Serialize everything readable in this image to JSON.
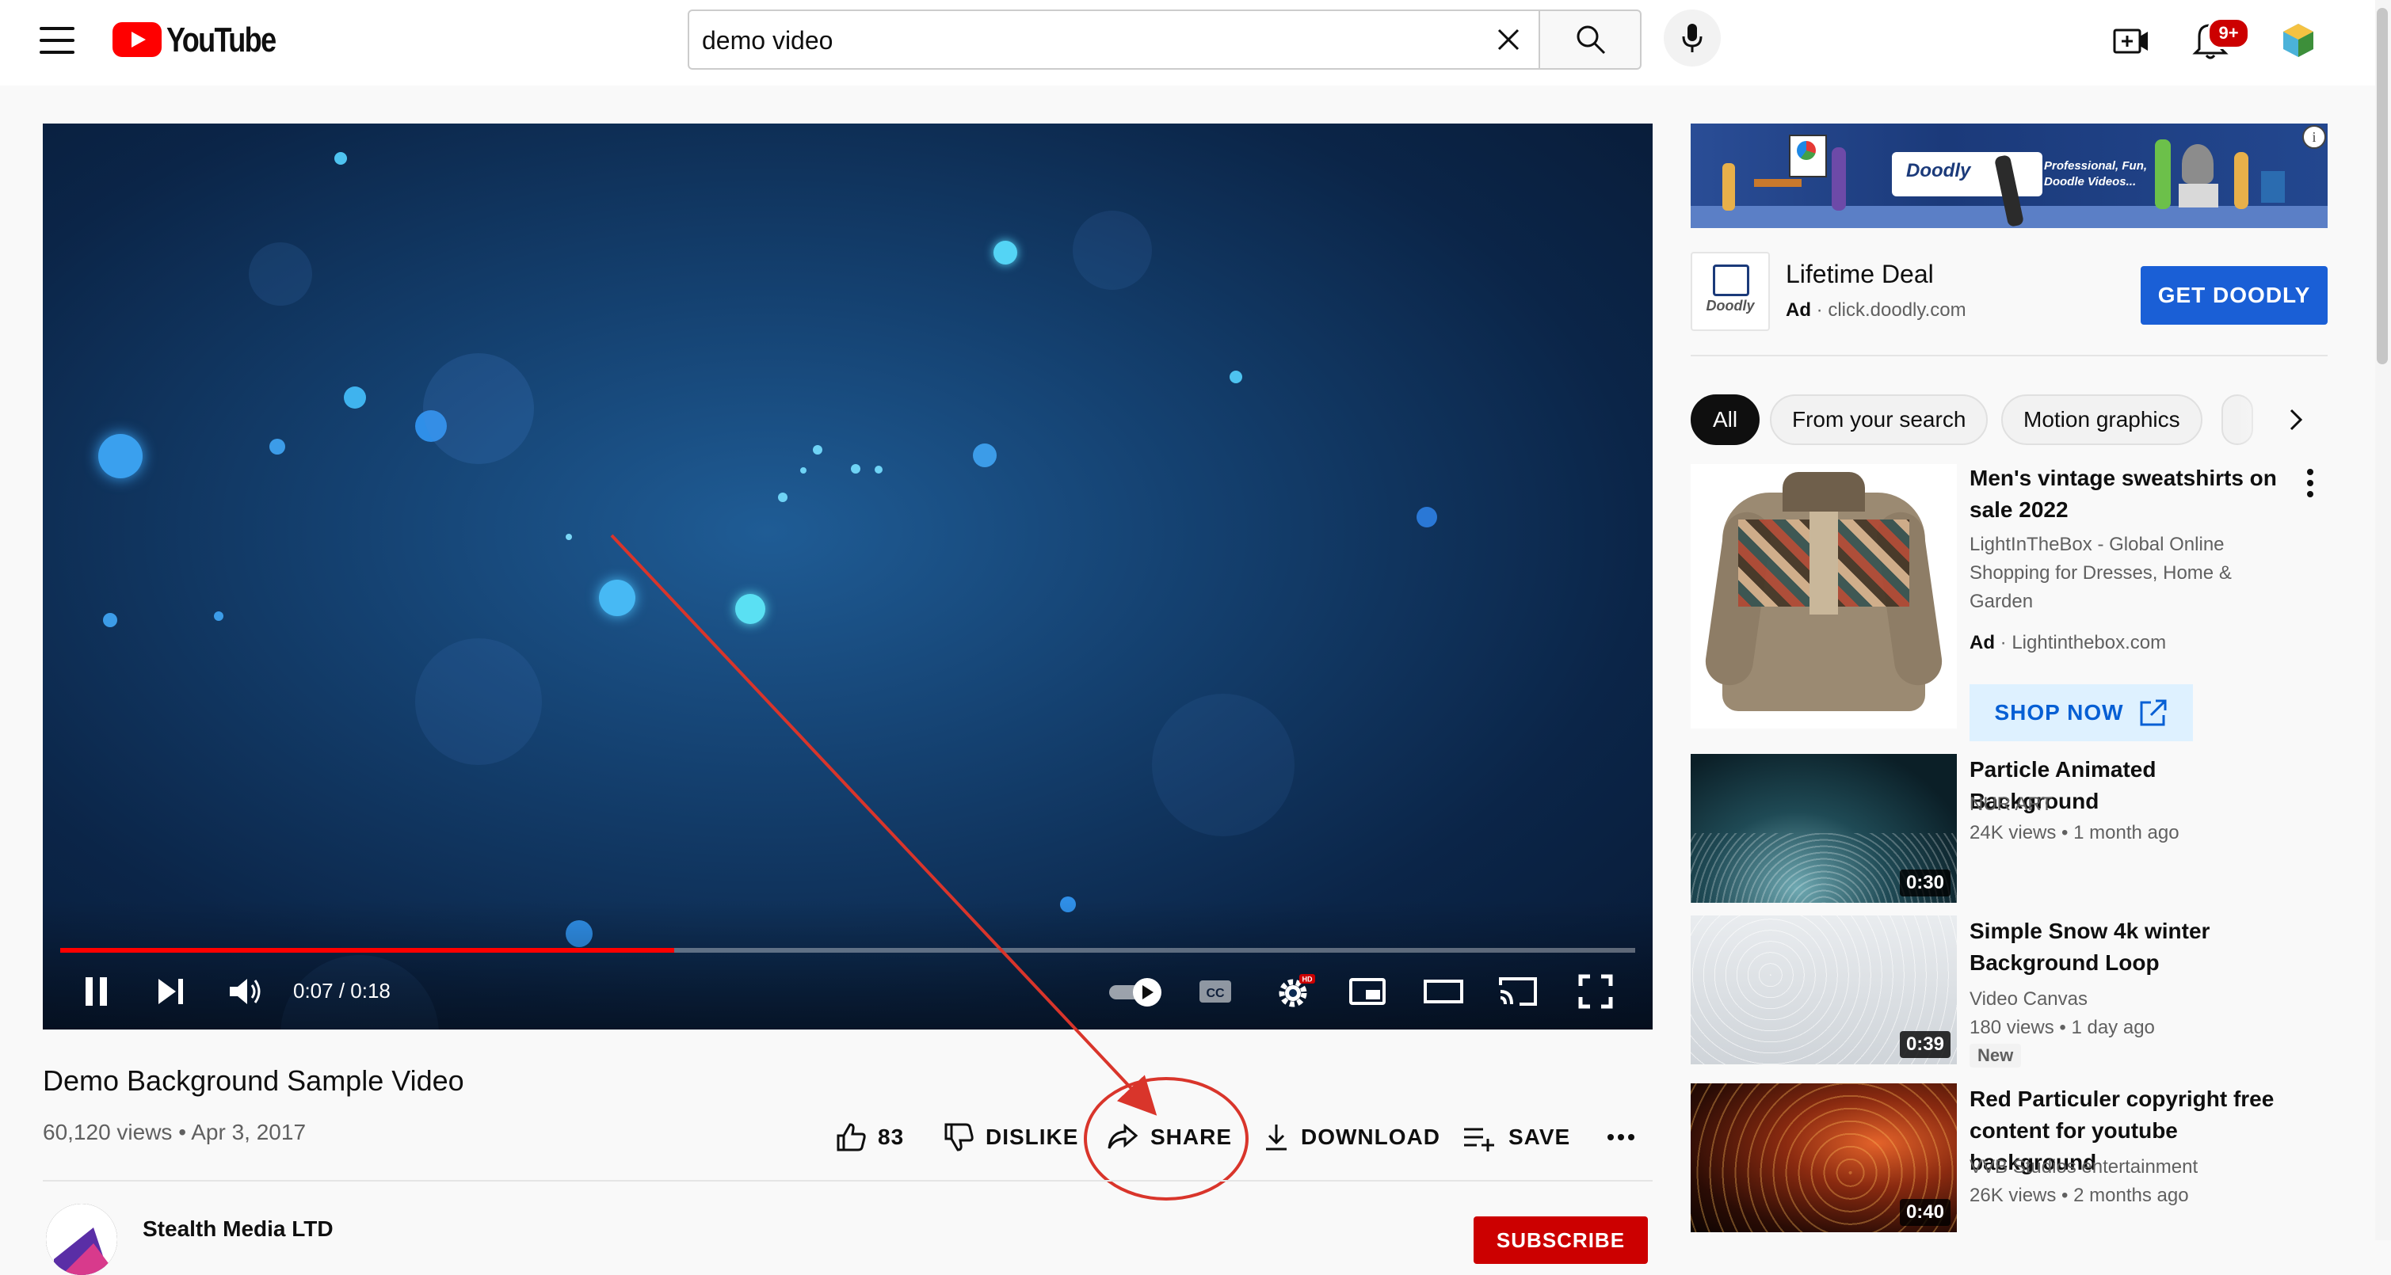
{
  "header": {
    "brand": "YouTube",
    "search_value": "demo video",
    "notification_count": "9+"
  },
  "player": {
    "time": "0:07 / 0:18",
    "progress": 0.39,
    "hd_badge": "HD"
  },
  "video": {
    "title": "Demo Background Sample Video",
    "meta": "60,120 views • Apr 3, 2017",
    "likes": "83",
    "dislike_label": "DISLIKE",
    "share_label": "SHARE",
    "download_label": "DOWNLOAD",
    "save_label": "SAVE"
  },
  "channel": {
    "name": "Stealth Media LTD",
    "subscribe_label": "SUBSCRIBE"
  },
  "ad": {
    "banner_brand": "Doodly",
    "banner_tagline": "Professional, Fun, Doodle Videos...",
    "logo_text": "Doodly",
    "title": "Lifetime Deal",
    "ad_label": "Ad",
    "domain": "click.doodly.com",
    "cta": "GET DOODLY"
  },
  "chips": [
    "All",
    "From your search",
    "Motion graphics"
  ],
  "recommendations": [
    {
      "title": "Men's vintage sweatshirts on sale 2022",
      "channel": "LightInTheBox - Global Online Shopping for Dresses, Home & Garden",
      "ad_label": "Ad",
      "domain": "Lightinthebox.com",
      "cta": "SHOP NOW"
    },
    {
      "title": "Particle Animated Background",
      "channel": "NUR ART",
      "stats": "24K views • 1 month ago",
      "duration": "0:30"
    },
    {
      "title": "Simple Snow 4k winter Background Loop",
      "channel": "Video Canvas",
      "stats": "180 views • 1 day ago",
      "badge": "New",
      "duration": "0:39"
    },
    {
      "title": "Red Particuler copyright free content for youtube background",
      "channel": "VVB Studios entertainment",
      "stats": "26K views • 2 months ago",
      "duration": "0:40"
    }
  ],
  "colors": {
    "brand_red": "#ff0000",
    "annotation_red": "#d9352b",
    "ad_button_blue": "#1a5fd6",
    "link_blue": "#065fd4"
  },
  "icons": [
    "menu-icon",
    "search-icon",
    "clear-icon",
    "mic-icon",
    "create-icon",
    "bell-icon",
    "pause-icon",
    "next-icon",
    "volume-icon",
    "autoplay-toggle",
    "captions-icon",
    "settings-icon",
    "miniplayer-icon",
    "theater-icon",
    "cast-icon",
    "fullscreen-icon",
    "like-icon",
    "dislike-icon",
    "share-icon",
    "download-icon",
    "save-icon",
    "more-icon",
    "chevron-right-icon",
    "external-link-icon"
  ]
}
